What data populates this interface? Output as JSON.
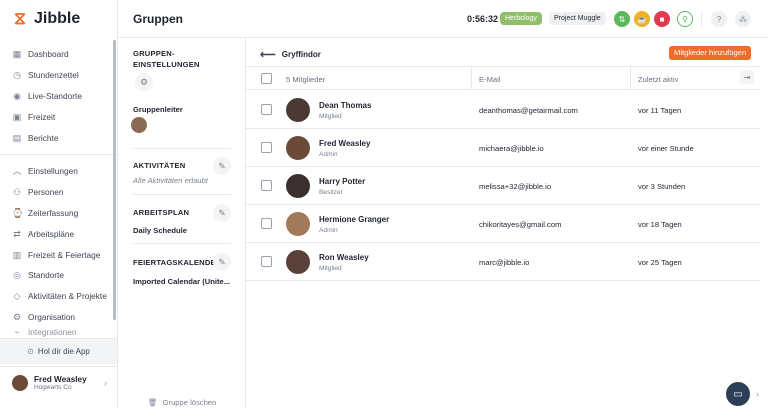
{
  "app": {
    "name": "Jibble"
  },
  "sidebar": {
    "items": [
      {
        "label": "Dashboard",
        "icon": "grid-icon"
      },
      {
        "label": "Stundenzettel",
        "icon": "clock-icon"
      },
      {
        "label": "Live-Standorte",
        "icon": "pin-icon"
      },
      {
        "label": "Freizeit",
        "icon": "bag-icon"
      },
      {
        "label": "Berichte",
        "icon": "report-icon"
      }
    ],
    "settings_items": [
      {
        "label": "Einstellungen",
        "icon": "chevron-up-icon"
      },
      {
        "label": "Personen",
        "icon": "people-icon"
      },
      {
        "label": "Zeiterfassung",
        "icon": "timer-icon"
      },
      {
        "label": "Arbeitspläne",
        "icon": "schedule-icon"
      },
      {
        "label": "Freizeit & Feiertage",
        "icon": "holiday-icon"
      },
      {
        "label": "Standorte",
        "icon": "location-icon"
      },
      {
        "label": "Aktivitäten & Projekte",
        "icon": "tag-icon"
      },
      {
        "label": "Organisation",
        "icon": "gear-icon"
      },
      {
        "label": "Integrationen",
        "icon": "plug-icon"
      }
    ],
    "get_app": "Hol dir die App",
    "user": {
      "name": "Fred Weasley",
      "org": "Hogwarts Co"
    }
  },
  "header": {
    "title": "Gruppen",
    "timer": "0:56:32",
    "activity": "Herbology",
    "project": "Project Muggle"
  },
  "settings_panel": {
    "group_settings": "GRUPPEN-EINSTELLUNGEN",
    "group_leader": "Gruppenleiter",
    "activities": "AKTIVITÄTEN",
    "activities_value": "Alle Aktivitäten erlaubt",
    "schedule": "ARBEITSPLAN",
    "schedule_value": "Daily Schedule",
    "holiday": "FEIERTAGSKALENDER",
    "holiday_value": "Imported Calendar (Unite...",
    "delete_group": "Gruppe löschen"
  },
  "main": {
    "group_name": "Gryffindor",
    "add_members": "Mitglieder hinzufügen",
    "columns": {
      "members": "5 Mitglieder",
      "email": "E-Mail",
      "last_active": "Zuletzt aktiv"
    },
    "rows": [
      {
        "name": "Dean Thomas",
        "role": "Mitglied",
        "email": "deanthomas@getairmail.com",
        "last_active": "vor 11 Tagen",
        "avatar_color": "#4a3a33"
      },
      {
        "name": "Fred Weasley",
        "role": "Admin",
        "email": "michaera@jibble.io",
        "last_active": "vor einer Stunde",
        "avatar_color": "#6b4a3a"
      },
      {
        "name": "Harry Potter",
        "role": "Besitzer",
        "email": "melissa+32@jibble.io",
        "last_active": "vor 3 Stunden",
        "avatar_color": "#3a3030"
      },
      {
        "name": "Hermione Granger",
        "role": "Admin",
        "email": "chikoritayes@gmail.com",
        "last_active": "vor 18 Tagen",
        "avatar_color": "#a07a5a"
      },
      {
        "name": "Ron Weasley",
        "role": "Mitglied",
        "email": "marc@jibble.io",
        "last_active": "vor 25 Tagen",
        "avatar_color": "#5a4038"
      }
    ]
  }
}
